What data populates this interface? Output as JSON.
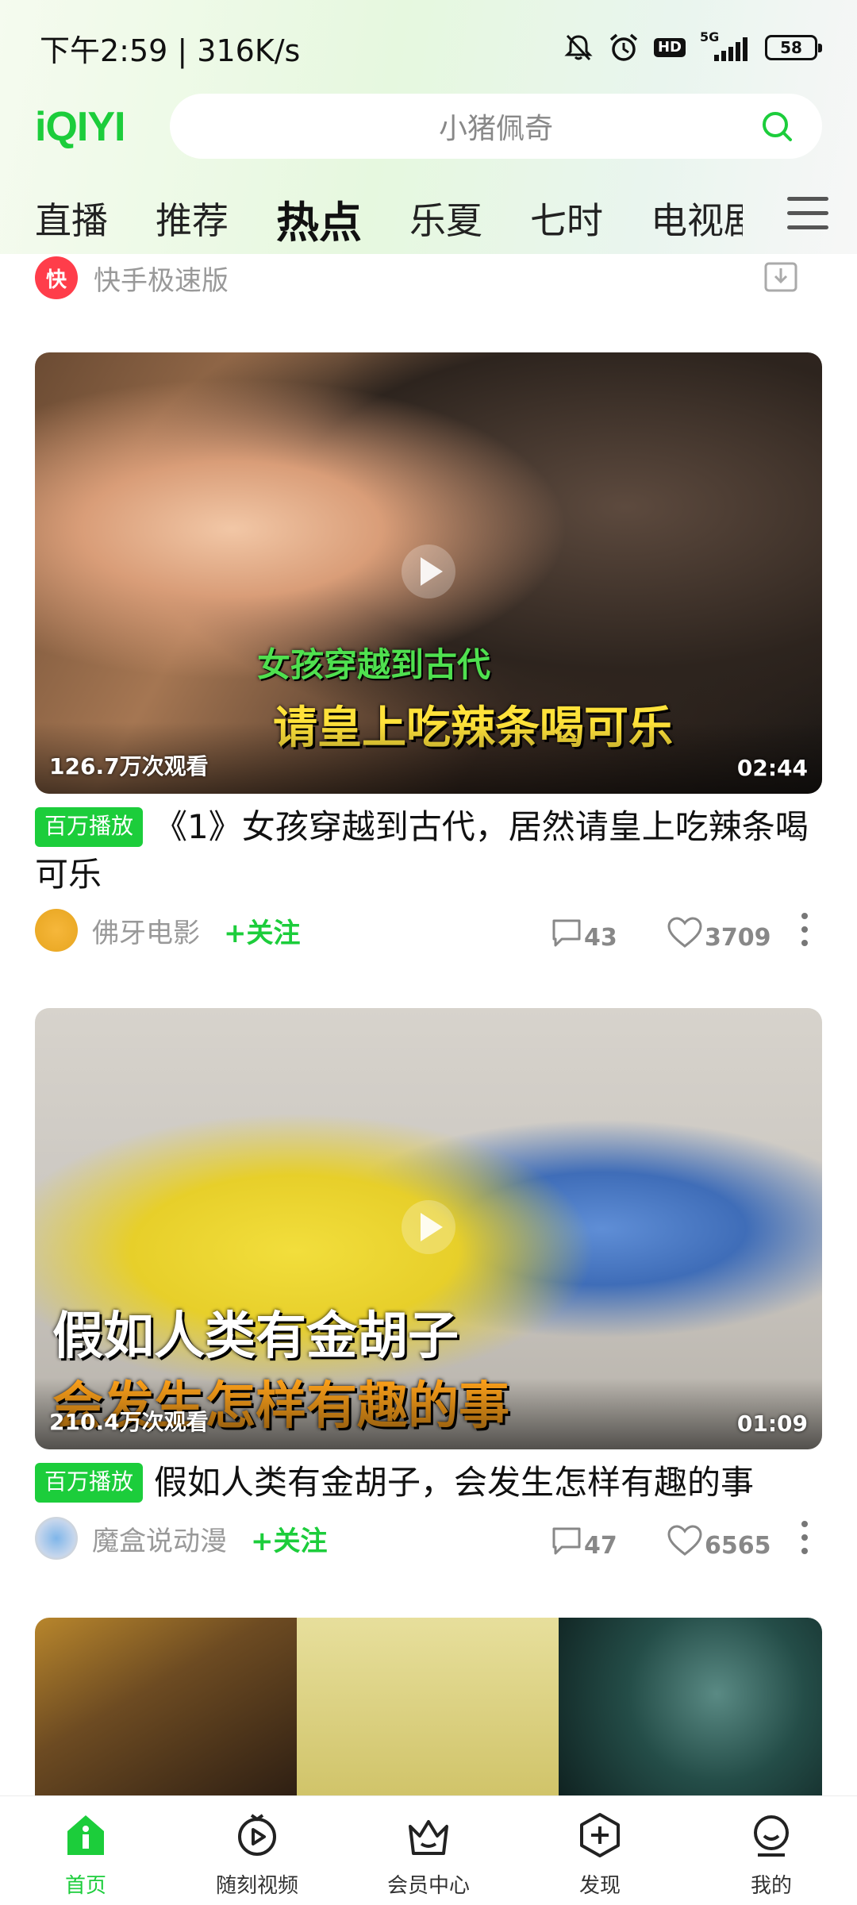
{
  "status_bar": {
    "time_speed": "下午2:59 | 316K/s",
    "network": "5G",
    "hd": "HD",
    "battery": "58"
  },
  "header": {
    "logo": "iQIYI",
    "search_placeholder": "小猪佩奇"
  },
  "tabs": [
    {
      "label": "直播",
      "active": false
    },
    {
      "label": "推荐",
      "active": false
    },
    {
      "label": "热点",
      "active": true
    },
    {
      "label": "乐夏",
      "active": false
    },
    {
      "label": "七时",
      "active": false
    },
    {
      "label": "电视剧",
      "active": false
    }
  ],
  "partial_ad": {
    "label": "快手极速版"
  },
  "feed": [
    {
      "thumb_text_1": "女孩穿越到古代",
      "thumb_text_2": "请皇上吃辣条喝可乐",
      "views": "126.7万次观看",
      "duration": "02:44",
      "badge": "百万播放",
      "title": "《1》女孩穿越到古代，居然请皇上吃辣条喝可乐",
      "author": "佛牙电影",
      "follow": "+关注",
      "comments": "43",
      "likes": "3709"
    },
    {
      "thumb_text_1": "假如人类有金胡子",
      "thumb_text_2": "会发生怎样有趣的事",
      "views": "210.4万次观看",
      "duration": "01:09",
      "badge": "百万播放",
      "title": "假如人类有金胡子，会发生怎样有趣的事",
      "author": "魔盒说动漫",
      "follow": "+关注",
      "comments": "47",
      "likes": "6565"
    }
  ],
  "bottom_nav": [
    {
      "label": "首页",
      "icon": "home-icon",
      "active": true
    },
    {
      "label": "随刻视频",
      "icon": "play-circle-icon",
      "active": false
    },
    {
      "label": "会员中心",
      "icon": "crown-icon",
      "active": false
    },
    {
      "label": "发现",
      "icon": "plus-hexagon-icon",
      "active": false
    },
    {
      "label": "我的",
      "icon": "profile-icon",
      "active": false
    }
  ],
  "colors": {
    "brand": "#1ccd3b",
    "text_muted": "#999999"
  }
}
